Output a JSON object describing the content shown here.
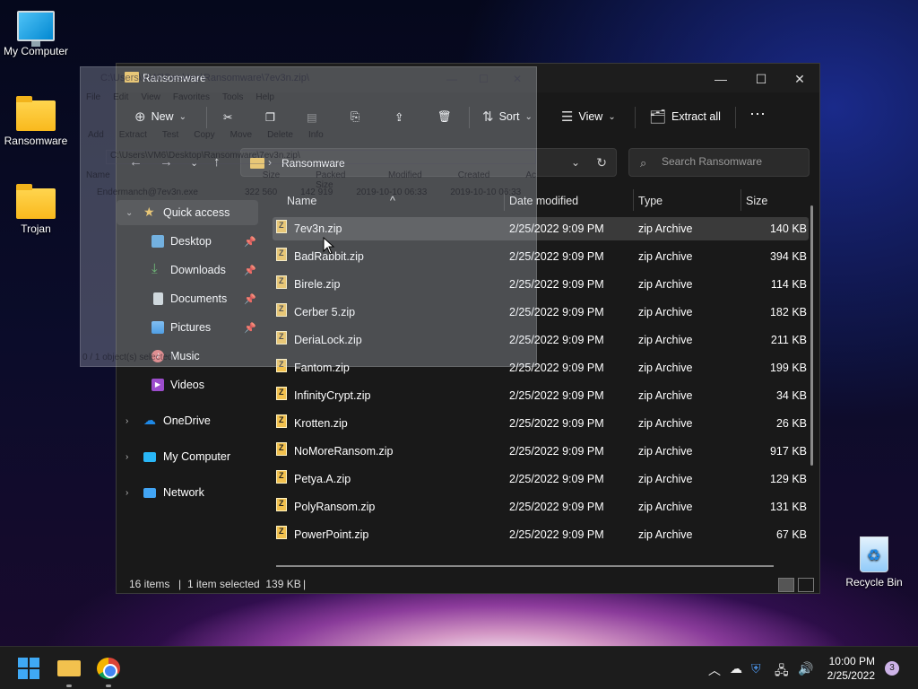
{
  "desktop": {
    "icons": [
      {
        "label": "My Computer"
      },
      {
        "label": "Ransomware"
      },
      {
        "label": "Trojan"
      },
      {
        "label": "Recycle Bin"
      }
    ]
  },
  "ghost_window": {
    "title": "C:\\Users\\VM6\\Desktop\\Ransomware\\7ev3n.zip\\",
    "menu": [
      "File",
      "Edit",
      "View",
      "Favorites",
      "Tools",
      "Help"
    ],
    "tools": [
      "Add",
      "Extract",
      "Test",
      "Copy",
      "Move",
      "Delete",
      "Info"
    ],
    "path": "C:\\Users\\VM6\\Desktop\\Ransomware\\7ev3n.zip\\",
    "headers": [
      "Name",
      "Size",
      "Packed Size",
      "Modified",
      "Created",
      "Ac"
    ],
    "row": [
      "Endermanch@7ev3n.exe",
      "322 560",
      "142 919",
      "2019-10-10 06:33",
      "2019-10-10 06:33"
    ],
    "status": "0 / 1 object(s) selected"
  },
  "explorer": {
    "title": "Ransomware",
    "commands": {
      "new": "New",
      "sort": "Sort",
      "view": "View",
      "extract_all": "Extract all"
    },
    "address": {
      "path": "Ransomware"
    },
    "search": {
      "placeholder": "Search Ransomware"
    },
    "sidebar": [
      {
        "label": "Quick access",
        "icon": "star-icon"
      },
      {
        "label": "Desktop",
        "icon": "desktop-icon"
      },
      {
        "label": "Downloads",
        "icon": "download-icon"
      },
      {
        "label": "Documents",
        "icon": "documents-icon"
      },
      {
        "label": "Pictures",
        "icon": "pictures-icon"
      },
      {
        "label": "Music",
        "icon": "music-icon"
      },
      {
        "label": "Videos",
        "icon": "videos-icon"
      },
      {
        "label": "OneDrive",
        "icon": "cloud-icon"
      },
      {
        "label": "My Computer",
        "icon": "computer-icon"
      },
      {
        "label": "Network",
        "icon": "network-icon"
      }
    ],
    "columns": {
      "name": "Name",
      "date": "Date modified",
      "type": "Type",
      "size": "Size"
    },
    "files": [
      {
        "name": "7ev3n.zip",
        "date": "2/25/2022 9:09 PM",
        "type": "zip Archive",
        "size": "140 KB"
      },
      {
        "name": "BadRabbit.zip",
        "date": "2/25/2022 9:09 PM",
        "type": "zip Archive",
        "size": "394 KB"
      },
      {
        "name": "Birele.zip",
        "date": "2/25/2022 9:09 PM",
        "type": "zip Archive",
        "size": "114 KB"
      },
      {
        "name": "Cerber 5.zip",
        "date": "2/25/2022 9:09 PM",
        "type": "zip Archive",
        "size": "182 KB"
      },
      {
        "name": "DeriaLock.zip",
        "date": "2/25/2022 9:09 PM",
        "type": "zip Archive",
        "size": "211 KB"
      },
      {
        "name": "Fantom.zip",
        "date": "2/25/2022 9:09 PM",
        "type": "zip Archive",
        "size": "199 KB"
      },
      {
        "name": "InfinityCrypt.zip",
        "date": "2/25/2022 9:09 PM",
        "type": "zip Archive",
        "size": "34 KB"
      },
      {
        "name": "Krotten.zip",
        "date": "2/25/2022 9:09 PM",
        "type": "zip Archive",
        "size": "26 KB"
      },
      {
        "name": "NoMoreRansom.zip",
        "date": "2/25/2022 9:09 PM",
        "type": "zip Archive",
        "size": "917 KB"
      },
      {
        "name": "Petya.A.zip",
        "date": "2/25/2022 9:09 PM",
        "type": "zip Archive",
        "size": "129 KB"
      },
      {
        "name": "PolyRansom.zip",
        "date": "2/25/2022 9:09 PM",
        "type": "zip Archive",
        "size": "131 KB"
      },
      {
        "name": "PowerPoint.zip",
        "date": "2/25/2022 9:09 PM",
        "type": "zip Archive",
        "size": "67 KB"
      }
    ],
    "status": {
      "items": "16 items",
      "selected": "1 item selected  139 KB"
    }
  },
  "taskbar": {
    "time": "10:00 PM",
    "date": "2/25/2022",
    "notifications": "3"
  }
}
